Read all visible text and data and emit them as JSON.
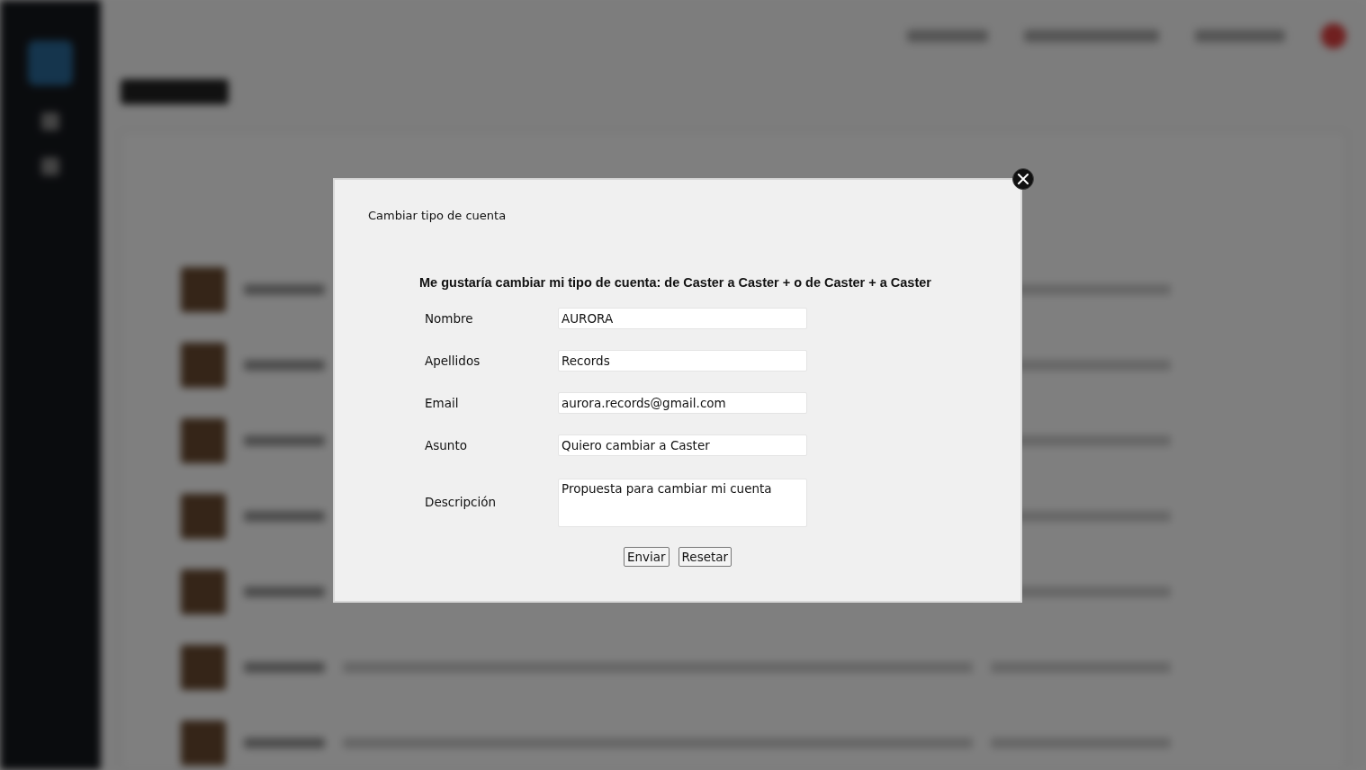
{
  "dialog": {
    "title": "Cambiar tipo de cuenta",
    "heading": "Me gustaría cambiar mi tipo de cuenta: de Caster a Caster + o de Caster + a Caster",
    "fields": [
      {
        "kind": "input",
        "label": "Nombre",
        "value": "AURORA"
      },
      {
        "kind": "input",
        "label": "Apellidos",
        "value": "Records"
      },
      {
        "kind": "input",
        "label": "Email",
        "value": "aurora.records@gmail.com"
      },
      {
        "kind": "input",
        "label": "Asunto",
        "value": "Quiero cambiar a Caster"
      },
      {
        "kind": "textarea",
        "label": "Descripción",
        "value": "Propuesta para cambiar mi cuenta"
      }
    ],
    "buttons": [
      "Enviar",
      "Resetar"
    ]
  }
}
